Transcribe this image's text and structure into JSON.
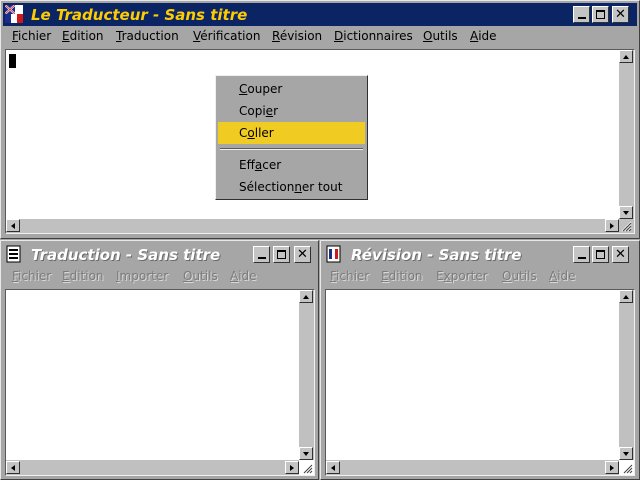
{
  "main_window": {
    "title": "Le Traducteur - Sans titre",
    "menu": [
      {
        "pre": "",
        "u": "F",
        "post": "ichier"
      },
      {
        "pre": "",
        "u": "E",
        "post": "dition"
      },
      {
        "pre": "",
        "u": "T",
        "post": "raduction"
      },
      {
        "pre": "",
        "u": "V",
        "post": "érification"
      },
      {
        "pre": "",
        "u": "R",
        "post": "évision"
      },
      {
        "pre": "",
        "u": "D",
        "post": "ictionnaires"
      },
      {
        "pre": "",
        "u": "O",
        "post": "utils"
      },
      {
        "pre": "",
        "u": "A",
        "post": "ide"
      }
    ]
  },
  "context_menu": {
    "items": [
      {
        "pre": "",
        "u": "C",
        "post": "ouper"
      },
      {
        "pre": "Copi",
        "u": "e",
        "post": "r"
      },
      {
        "pre": "C",
        "u": "o",
        "post": "ller"
      },
      {
        "pre": "Eff",
        "u": "a",
        "post": "cer"
      },
      {
        "pre": "Sélection",
        "u": "n",
        "post": "er tout"
      }
    ],
    "highlighted_index": 2,
    "highlight_color": "#f0cc22"
  },
  "translation_window": {
    "title": "Traduction - Sans titre",
    "menu": [
      {
        "pre": "",
        "u": "F",
        "post": "ichier"
      },
      {
        "pre": "",
        "u": "E",
        "post": "dition"
      },
      {
        "pre": "",
        "u": "I",
        "post": "mporter"
      },
      {
        "pre": "",
        "u": "O",
        "post": "utils"
      },
      {
        "pre": "",
        "u": "A",
        "post": "ide"
      }
    ]
  },
  "revision_window": {
    "title": "Révision - Sans titre",
    "menu": [
      {
        "pre": "",
        "u": "F",
        "post": "ichier"
      },
      {
        "pre": "",
        "u": "E",
        "post": "dition"
      },
      {
        "pre": "E",
        "u": "x",
        "post": "porter"
      },
      {
        "pre": "",
        "u": "O",
        "post": "utils"
      },
      {
        "pre": "",
        "u": "A",
        "post": "ide"
      }
    ]
  },
  "icons": [
    "app-flag-icon",
    "translation-doc-icon",
    "revision-doc-icon",
    "minimize-icon",
    "maximize-icon",
    "close-icon"
  ],
  "colors": {
    "active_title_bg": "#0a2464",
    "active_title_text": "#ffcc00",
    "window_bg": "#a7a6a6"
  }
}
